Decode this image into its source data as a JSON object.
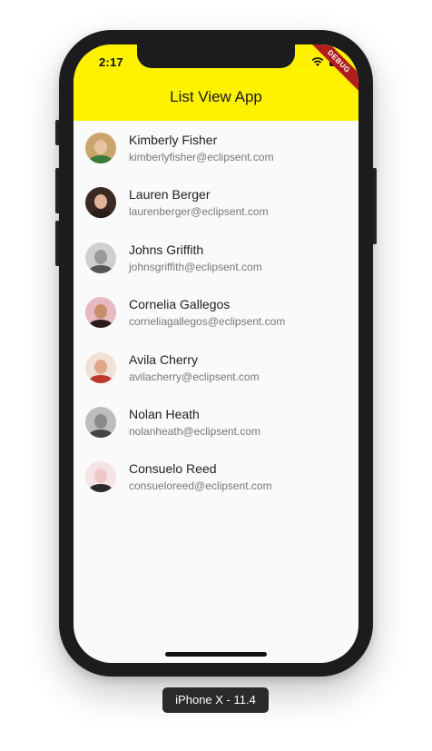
{
  "status_bar": {
    "time": "2:17",
    "signal_dots": "....",
    "wifi_icon": "wifi-icon",
    "battery_icon": "battery-icon"
  },
  "debug_banner": "DEBUG",
  "app_bar": {
    "title": "List View App",
    "background_color": "#fff200"
  },
  "contacts": [
    {
      "name": "Kimberly Fisher",
      "email": "kimberlyfisher@eclipsent.com",
      "avatar_bg": "#c9a56c",
      "avatar_face": "#e8c3a0",
      "avatar_shoulders": "#3a7a3a"
    },
    {
      "name": "Lauren Berger",
      "email": "laurenberger@eclipsent.com",
      "avatar_bg": "#3b2a22",
      "avatar_face": "#e0b49a",
      "avatar_shoulders": "#2a1d18"
    },
    {
      "name": "Johns Griffith",
      "email": "johnsgriffith@eclipsent.com",
      "avatar_bg": "#cfcfcf",
      "avatar_face": "#9a9a9a",
      "avatar_shoulders": "#555555"
    },
    {
      "name": "Cornelia Gallegos",
      "email": "corneliagallegos@eclipsent.com",
      "avatar_bg": "#e8b9c0",
      "avatar_face": "#c98c6c",
      "avatar_shoulders": "#2b1a1a"
    },
    {
      "name": "Avila Cherry",
      "email": "avilacherry@eclipsent.com",
      "avatar_bg": "#f0e2d6",
      "avatar_face": "#e2a78a",
      "avatar_shoulders": "#c0392b"
    },
    {
      "name": "Nolan Heath",
      "email": "nolanheath@eclipsent.com",
      "avatar_bg": "#bdbdbd",
      "avatar_face": "#8a8a8a",
      "avatar_shoulders": "#444444"
    },
    {
      "name": "Consuelo Reed",
      "email": "consueloreed@eclipsent.com",
      "avatar_bg": "#f6e3e6",
      "avatar_face": "#efc9c9",
      "avatar_shoulders": "#2b2b2b"
    }
  ],
  "device_label": "iPhone X - 11.4"
}
